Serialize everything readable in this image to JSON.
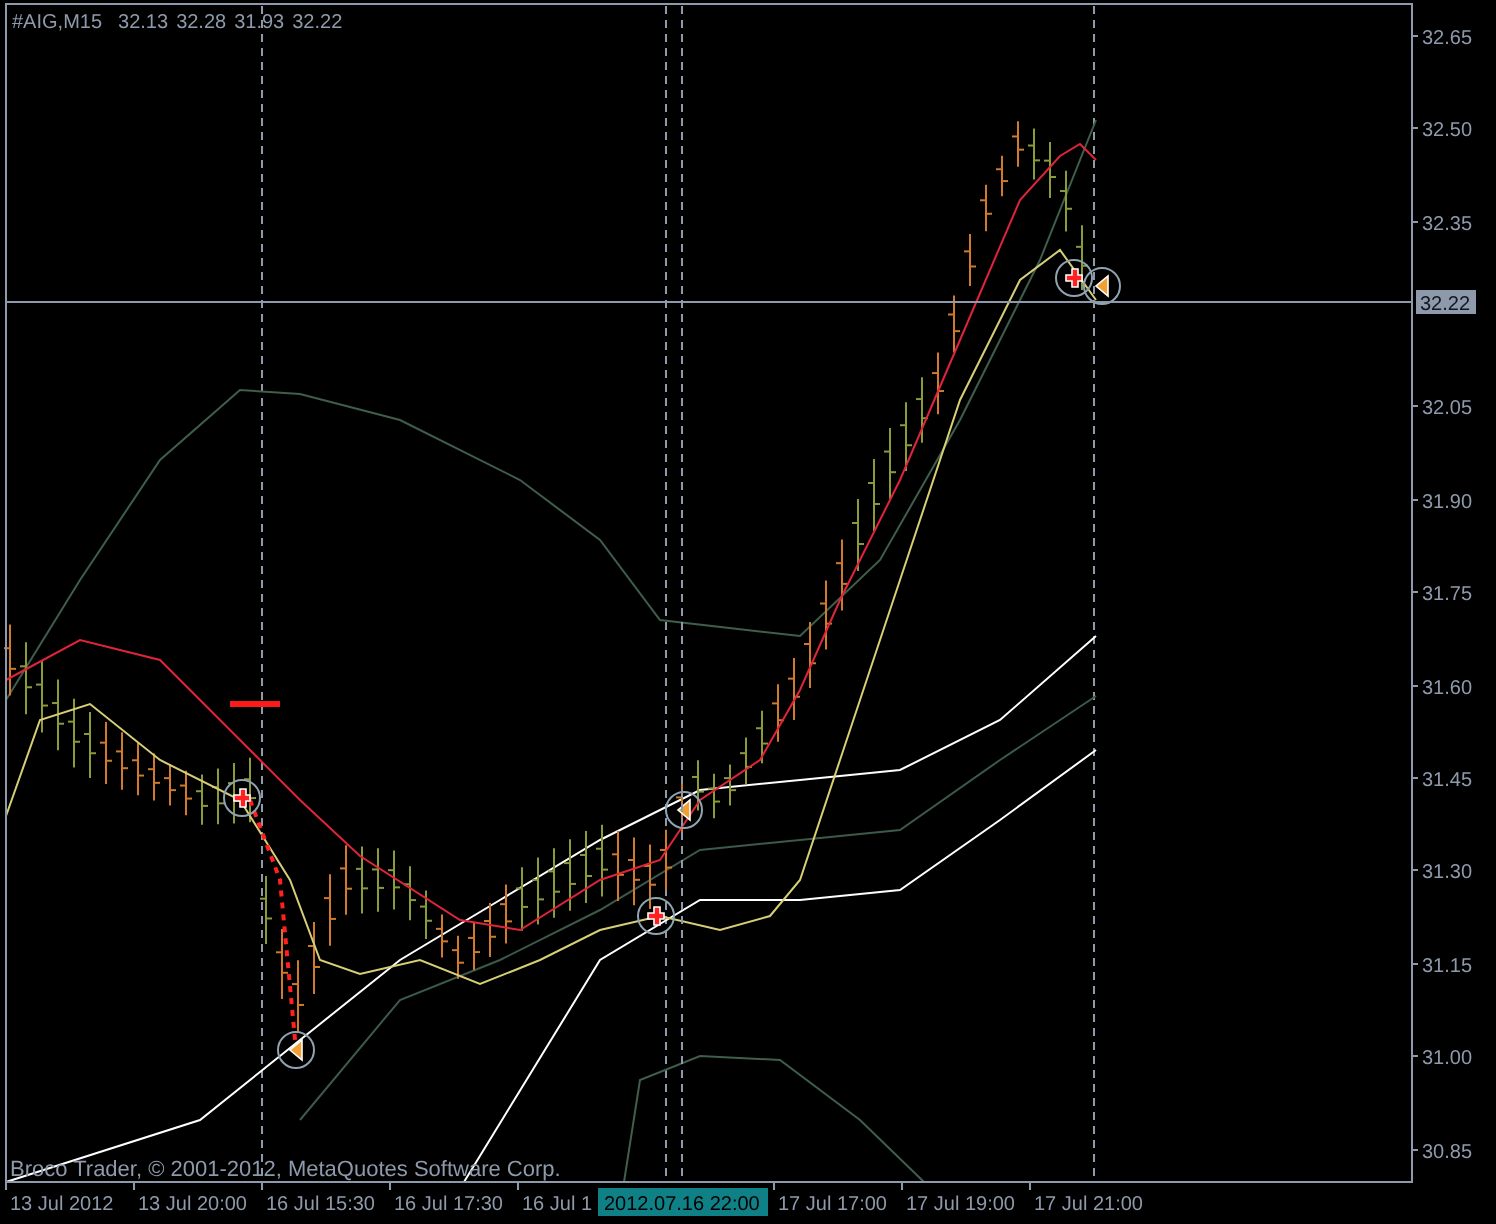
{
  "chart": {
    "symbol": "#AIG,M15",
    "quotes": [
      "32.13",
      "32.28",
      "31.93",
      "32.22"
    ],
    "price_axis": [
      "32.65",
      "32.50",
      "32.35",
      "32.05",
      "31.90",
      "31.75",
      "31.60",
      "31.45",
      "31.30",
      "31.15",
      "31.00",
      "30.85"
    ],
    "current_price": "32.22",
    "time_axis": [
      "13 Jul 2012",
      "13 Jul 20:00",
      "16 Jul 15:30",
      "16 Jul 17:30",
      "16 Jul 1",
      "17 Jul 17:00",
      "17 Jul 19:00",
      "17 Jul 21:00"
    ],
    "cursor_time": "2012.07.16 22:00",
    "copyright": "Broco Trader, © 2001-2012, MetaQuotes Software Corp."
  }
}
